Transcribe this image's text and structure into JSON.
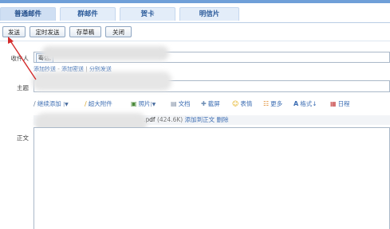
{
  "tabs": [
    "普通邮件",
    "群邮件",
    "贺卡",
    "明信片"
  ],
  "toolbar": {
    "send": "发送",
    "scheduled_send": "定时发送",
    "save_draft": "存草稿",
    "close": "关闭"
  },
  "form": {
    "recipients_label": "收件人",
    "recipient_chip": "骞佸,",
    "add_cc": "添加抄送",
    "add_bcc": "添加密送",
    "separate_send": "分别发送",
    "subject_label": "主题",
    "body_label": "正文"
  },
  "attach_toolbar": {
    "continue_add": "继续添加",
    "large_attachment": "超大附件",
    "photo": "照片",
    "document": "文档",
    "screenshot": "截屏",
    "emoji": "表情",
    "more": "更多",
    "format": "格式↓",
    "schedule": "日程"
  },
  "attachment": {
    "extension": ".pdf",
    "size": "(424.6K)",
    "add_to_body": "添加到正文",
    "delete": "删除"
  },
  "colors": {
    "accent": "#6f9fd8",
    "link": "#3d6eb3",
    "arrow": "#d42a2a"
  }
}
